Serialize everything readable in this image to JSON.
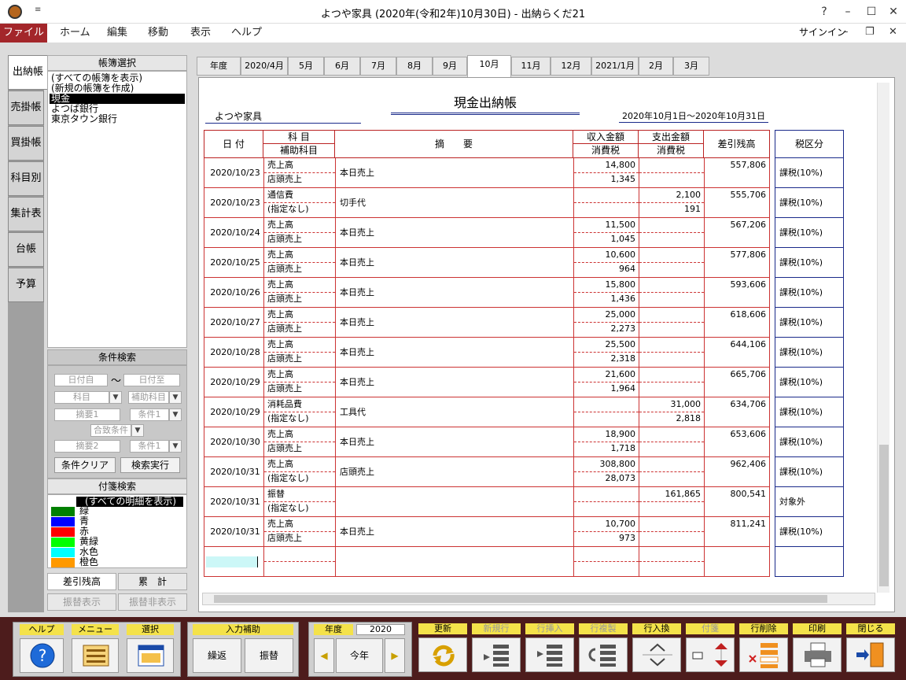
{
  "window": {
    "title": "よつや家具 (2020年(令和2年)10月30日) - 出納らくだ21",
    "quick_access": "≡",
    "help": "?",
    "minimize": "–",
    "maximize": "☐",
    "close": "✕"
  },
  "ribbon": {
    "file": "ファイル",
    "tabs": [
      "ホーム",
      "編集",
      "移動",
      "表示",
      "ヘルプ"
    ],
    "signin": "サインイン",
    "min": "–",
    "restore": "❐",
    "close": "✕"
  },
  "side_tabs": [
    "出納帳",
    "売掛帳",
    "買掛帳",
    "科目別",
    "集計表",
    "台帳",
    "予算"
  ],
  "book_select": {
    "header": "帳簿選択",
    "items": [
      "(すべての帳簿を表示)",
      "(新規の帳簿を作成)",
      "現金",
      "よつば銀行",
      "東京タウン銀行"
    ],
    "selected": 2
  },
  "condition_search": {
    "header": "条件検索",
    "date_from": "日付自",
    "tilde": "～",
    "date_to": "日付至",
    "account": "科目",
    "sub_account": "補助科目",
    "memo1": "摘要1",
    "cond1": "条件1",
    "match": "合致条件",
    "memo2": "摘要2",
    "cond2": "条件1",
    "clear_btn": "条件クリア",
    "run_btn": "検索実行"
  },
  "tag_search": {
    "header": "付箋検索",
    "all": "(すべての明細を表示)",
    "tags": [
      {
        "label": "緑",
        "color": "#008000"
      },
      {
        "label": "青",
        "color": "#0000ff"
      },
      {
        "label": "赤",
        "color": "#ff0000"
      },
      {
        "label": "黄緑",
        "color": "#00ff00"
      },
      {
        "label": "水色",
        "color": "#00ffff"
      },
      {
        "label": "橙色",
        "color": "#ff9900"
      }
    ]
  },
  "lower_tabs": {
    "balance": "差引残高",
    "cumulative": "累　計",
    "transfer_show": "振替表示",
    "transfer_hide": "振替非表示"
  },
  "month_tabs": [
    "年度",
    "2020/4月",
    "5月",
    "6月",
    "7月",
    "8月",
    "9月",
    "10月",
    "11月",
    "12月",
    "2021/1月",
    "2月",
    "3月"
  ],
  "active_month": 7,
  "ledger": {
    "title": "現金出納帳",
    "company": "よつや家具",
    "period": "2020年10月1日～2020年10月31日",
    "headers": {
      "date": "日 付",
      "account": "科 目",
      "sub_account": "補助科目",
      "memo": "摘　　要",
      "income": "収入金額",
      "income_tax": "消費税",
      "expense": "支出金額",
      "expense_tax": "消費税",
      "balance": "差引残高",
      "tax_class": "税区分"
    },
    "rows": [
      {
        "date": "2020/10/23",
        "account": "売上高",
        "sub": "店頭売上",
        "memo": "本日売上",
        "income": "14,800",
        "income_tax": "1,345",
        "expense": "",
        "expense_tax": "",
        "balance": "557,806",
        "tax": "課税(10%)"
      },
      {
        "date": "2020/10/23",
        "account": "通信費",
        "sub": "(指定なし)",
        "memo": "切手代",
        "income": "",
        "income_tax": "",
        "expense": "2,100",
        "expense_tax": "191",
        "balance": "555,706",
        "tax": "課税(10%)"
      },
      {
        "date": "2020/10/24",
        "account": "売上高",
        "sub": "店頭売上",
        "memo": "本日売上",
        "income": "11,500",
        "income_tax": "1,045",
        "expense": "",
        "expense_tax": "",
        "balance": "567,206",
        "tax": "課税(10%)"
      },
      {
        "date": "2020/10/25",
        "account": "売上高",
        "sub": "店頭売上",
        "memo": "本日売上",
        "income": "10,600",
        "income_tax": "964",
        "expense": "",
        "expense_tax": "",
        "balance": "577,806",
        "tax": "課税(10%)"
      },
      {
        "date": "2020/10/26",
        "account": "売上高",
        "sub": "店頭売上",
        "memo": "本日売上",
        "income": "15,800",
        "income_tax": "1,436",
        "expense": "",
        "expense_tax": "",
        "balance": "593,606",
        "tax": "課税(10%)"
      },
      {
        "date": "2020/10/27",
        "account": "売上高",
        "sub": "店頭売上",
        "memo": "本日売上",
        "income": "25,000",
        "income_tax": "2,273",
        "expense": "",
        "expense_tax": "",
        "balance": "618,606",
        "tax": "課税(10%)"
      },
      {
        "date": "2020/10/28",
        "account": "売上高",
        "sub": "店頭売上",
        "memo": "本日売上",
        "income": "25,500",
        "income_tax": "2,318",
        "expense": "",
        "expense_tax": "",
        "balance": "644,106",
        "tax": "課税(10%)"
      },
      {
        "date": "2020/10/29",
        "account": "売上高",
        "sub": "店頭売上",
        "memo": "本日売上",
        "income": "21,600",
        "income_tax": "1,964",
        "expense": "",
        "expense_tax": "",
        "balance": "665,706",
        "tax": "課税(10%)"
      },
      {
        "date": "2020/10/29",
        "account": "消耗品費",
        "sub": "(指定なし)",
        "memo": "工具代",
        "income": "",
        "income_tax": "",
        "expense": "31,000",
        "expense_tax": "2,818",
        "balance": "634,706",
        "tax": "課税(10%)"
      },
      {
        "date": "2020/10/30",
        "account": "売上高",
        "sub": "店頭売上",
        "memo": "本日売上",
        "income": "18,900",
        "income_tax": "1,718",
        "expense": "",
        "expense_tax": "",
        "balance": "653,606",
        "tax": "課税(10%)"
      },
      {
        "date": "2020/10/31",
        "account": "売上高",
        "sub": "(指定なし)",
        "memo": "店頭売上",
        "income": "308,800",
        "income_tax": "28,073",
        "expense": "",
        "expense_tax": "",
        "balance": "962,406",
        "tax": "課税(10%)"
      },
      {
        "date": "2020/10/31",
        "account": "振替",
        "sub": "(指定なし)",
        "memo": "",
        "income": "",
        "income_tax": "",
        "expense": "161,865",
        "expense_tax": "",
        "balance": "800,541",
        "tax": "対象外"
      },
      {
        "date": "2020/10/31",
        "account": "売上高",
        "sub": "店頭売上",
        "memo": "本日売上",
        "income": "10,700",
        "income_tax": "973",
        "expense": "",
        "expense_tax": "",
        "balance": "811,241",
        "tax": "課税(10%)"
      }
    ]
  },
  "toolbar": {
    "help": "ヘルプ",
    "menu": "メニュー",
    "select": "選択",
    "input_assist": "入力補助",
    "repeat": "繰返",
    "transfer": "振替",
    "year_label": "年度",
    "year_value": "2020",
    "this_year": "今年",
    "update": "更新",
    "new_row": "新規行",
    "insert_row": "行挿入",
    "copy_row": "行複製",
    "swap_row": "行入換",
    "tag": "付箋",
    "delete_row": "行削除",
    "print": "印刷",
    "close": "閉じる"
  }
}
